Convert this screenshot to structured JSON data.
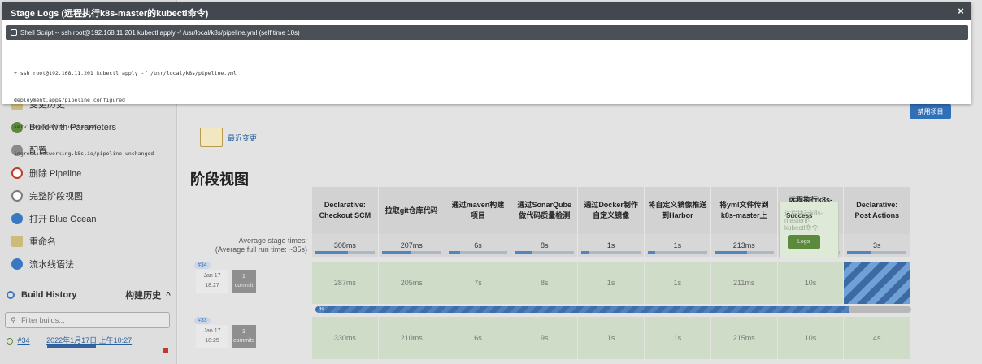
{
  "modal": {
    "title": "Stage Logs (远程执行k8s-master的kubectl命令)",
    "close_glyph": "×",
    "shell_toggle": "−",
    "shell_label": "Shell Script -- ssh root@192.168.11.201 kubectl apply -f /usr/local/k8s/pipeline.yml (self time 10s)",
    "log_lines": [
      "+ ssh root@192.168.11.201 kubectl apply -f /usr/local/k8s/pipeline.yml",
      "deployment.apps/pipeline configured",
      "service/pipeline unchanged",
      "ingress.networking.k8s.io/pipeline unchanged"
    ]
  },
  "sidebar": {
    "items": [
      {
        "label": "变更历史",
        "icon": "notepad-icon"
      },
      {
        "label": "Build with Parameters",
        "icon": "build-params-icon"
      },
      {
        "label": "配置",
        "icon": "gear-icon"
      },
      {
        "label": "删除 Pipeline",
        "icon": "delete-icon"
      },
      {
        "label": "完整阶段视图",
        "icon": "search-icon"
      },
      {
        "label": "打开 Blue Ocean",
        "icon": "blue-ocean-icon"
      },
      {
        "label": "重命名",
        "icon": "rename-icon"
      },
      {
        "label": "流水线语法",
        "icon": "help-icon"
      }
    ],
    "build_history": "Build History",
    "build_history_cn": "构建历史",
    "caret": "^",
    "filter_placeholder": "Filter builds...",
    "build_number": "#34",
    "build_date": "2022年1月17日 上午10:27"
  },
  "main": {
    "disable_label": "禁用项目",
    "recent_changes": "最近变更",
    "stage_view_title": "阶段视图",
    "avg_label_1": "Average stage times:",
    "avg_label_2": "(Average full run time: ~35s)",
    "stages": [
      {
        "name": "Declarative: Checkout SCM",
        "avg": "308ms"
      },
      {
        "name": "拉取git仓库代码",
        "avg": "207ms"
      },
      {
        "name": "通过maven构建项目",
        "avg": "6s"
      },
      {
        "name": "通过SonarQube做代码质量检测",
        "avg": "8s"
      },
      {
        "name": "通过Docker制作自定义镜像",
        "avg": "1s"
      },
      {
        "name": "将自定义镜像推送到Harbor",
        "avg": "1s"
      },
      {
        "name": "将yml文件传到k8s-master上",
        "avg": "213ms"
      },
      {
        "name": "远程执行k8s-master的kubectl命令",
        "avg": "10s"
      },
      {
        "name": "Declarative: Post Actions",
        "avg": "3s"
      }
    ],
    "builds": [
      {
        "num": "#34",
        "month_day": "Jan 17",
        "time": "18:27",
        "commits": "1",
        "commit_label": "commit",
        "times": [
          "287ms",
          "205ms",
          "7s",
          "8s",
          "1s",
          "1s",
          "211ms",
          "10s",
          ""
        ]
      },
      {
        "num": "#33",
        "month_day": "Jan 17",
        "time": "18:25",
        "commits": "3",
        "commit_label": "commits",
        "times": [
          "330ms",
          "210ms",
          "6s",
          "9s",
          "1s",
          "1s",
          "215ms",
          "10s",
          "4s"
        ]
      }
    ],
    "progress_label": "3s",
    "progress_fraction": 0.895,
    "popup": {
      "line1": "远程执行k8s-",
      "line2": "master的",
      "line3": "kubectl命令",
      "status": "Success",
      "logs_label": "Logs"
    }
  }
}
